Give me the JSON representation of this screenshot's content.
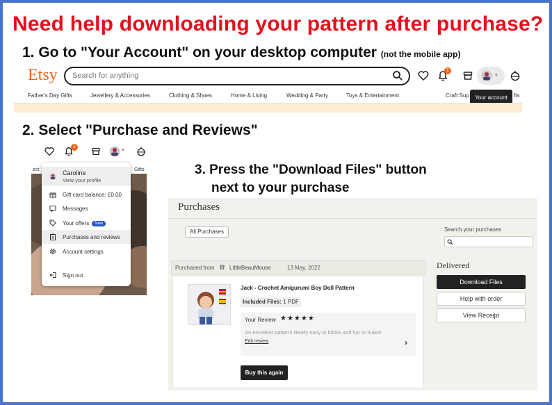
{
  "title": "Need help downloading your pattern after purchase?",
  "step1": {
    "text": "1. Go to \"Your Account\" on your desktop computer",
    "note": "(not the mobile app)"
  },
  "step2": {
    "text": "2. Select \"Purchase and Reviews\""
  },
  "step3": {
    "line1": "3. Press the \"Download Files\" button",
    "line2": "next to your purchase"
  },
  "etsy_header": {
    "logo": "Etsy",
    "search_placeholder": "Search for anything",
    "notification_count": "1",
    "tooltip": "Your account",
    "categories": [
      "Father's Day Gifts",
      "Jewellery & Accessories",
      "Clothing & Shoes",
      "Home & Living",
      "Wedding & Party",
      "Toys & Entertainment",
      "Craft Sup",
      "fts"
    ],
    "colors": {
      "brand": "#f1641e",
      "banner": "#fdebd2"
    }
  },
  "account_menu": {
    "notification_count": "1",
    "side_left": "ect",
    "side_right": "Gifts",
    "user_name": "Caroline",
    "profile_link": "View your profile",
    "items": [
      {
        "label": "Gift card balance: £0.00",
        "icon": "gift-icon"
      },
      {
        "label": "Messages",
        "icon": "message-icon"
      },
      {
        "label": "Your offers",
        "icon": "tag-icon",
        "badge": "New"
      },
      {
        "label": "Purchases and reviews",
        "icon": "clipboard-icon"
      },
      {
        "label": "Account settings",
        "icon": "gear-icon"
      },
      {
        "label": "Sign out",
        "icon": "sign-out-icon"
      }
    ]
  },
  "purchases": {
    "heading": "Purchases",
    "filter": "All Purchases",
    "search_label": "Search your purchases",
    "purchased_from": "Purchased from",
    "shop": "LittleBeauMouse",
    "date": "13 May, 2022",
    "product_title": "Jack - Crochet Amigurumi Boy Doll Pattern",
    "included_label": "Included Files:",
    "included_value": "1 PDF",
    "review_label": "Your Review",
    "review_stars": "★★★★★",
    "review_text": "An excellent pattern! Really easy to follow and fun to make!",
    "edit_review": "Edit review",
    "buy_again": "Buy this again",
    "status": "Delivered",
    "download_button": "Download Files",
    "help_button": "Help with order",
    "receipt_button": "View Receipt"
  }
}
